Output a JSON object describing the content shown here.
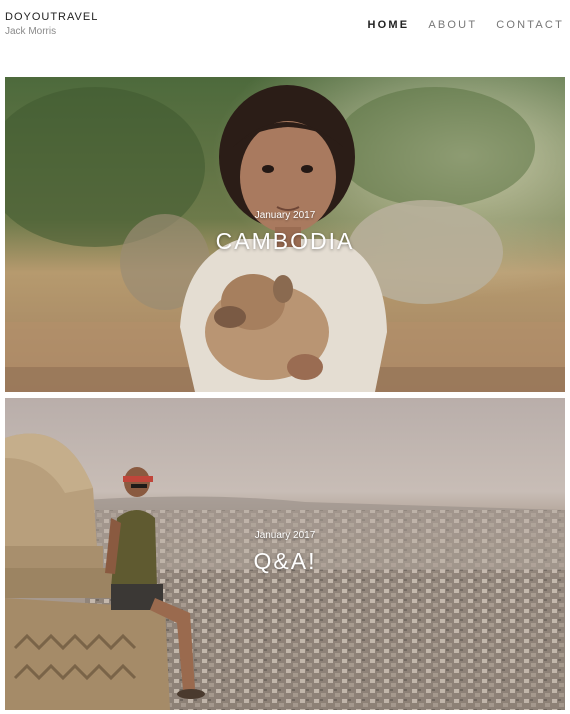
{
  "site": {
    "title": "DOYOUTRAVEL",
    "author": "Jack Morris"
  },
  "nav": {
    "items": [
      {
        "label": "HOME",
        "active": true
      },
      {
        "label": "ABOUT",
        "active": false
      },
      {
        "label": "CONTACT",
        "active": false
      }
    ]
  },
  "posts": [
    {
      "date": "January 2017",
      "title": "CAMBODIA",
      "image": "girl-holding-puppy-photo"
    },
    {
      "date": "January 2017",
      "title": "Q&A!",
      "image": "man-on-dome-over-city-photo"
    }
  ],
  "colors": {
    "text": "#222222",
    "nav_inactive": "#777777",
    "subtitle": "#8a8a8a",
    "overlay_text": "#ffffff"
  }
}
